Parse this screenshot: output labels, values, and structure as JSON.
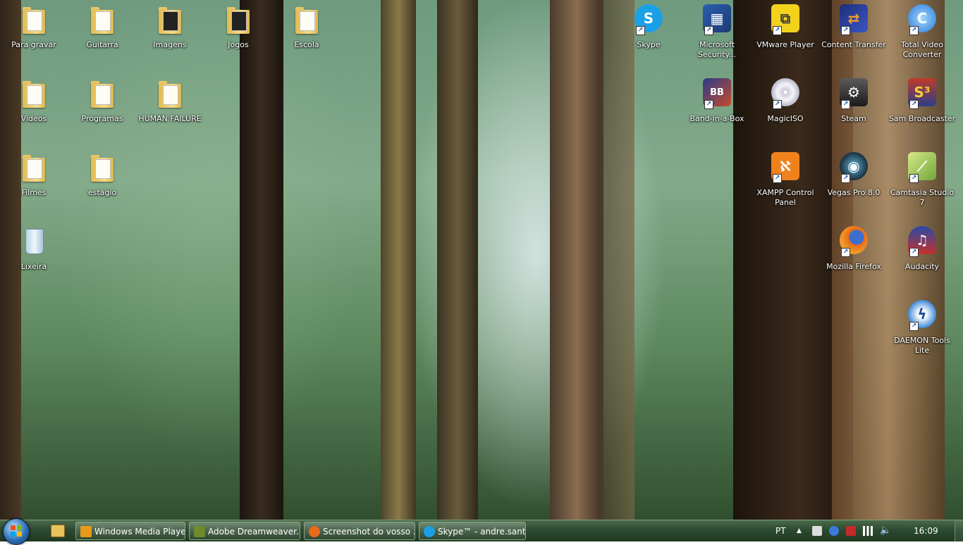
{
  "desktop": {
    "icons": [
      {
        "label": "Para gravar",
        "icon": "folder-icon"
      },
      {
        "label": "Guitarra",
        "icon": "folder-icon"
      },
      {
        "label": "Imagens",
        "icon": "folder-icon"
      },
      {
        "label": "Jogos",
        "icon": "folder-icon"
      },
      {
        "label": "Escola",
        "icon": "folder-icon"
      },
      {
        "label": "Videos",
        "icon": "folder-icon"
      },
      {
        "label": "Programas",
        "icon": "folder-icon"
      },
      {
        "label": "HUMAN FAILURE",
        "icon": "folder-icon"
      },
      {
        "label": "Filmes",
        "icon": "folder-icon"
      },
      {
        "label": "estagio",
        "icon": "folder-icon"
      },
      {
        "label": "Lixeira",
        "icon": "recycle-bin-icon"
      },
      {
        "label": "Skype",
        "icon": "skype-icon"
      },
      {
        "label": "Microsoft Security...",
        "icon": "security-icon"
      },
      {
        "label": "VMware Player",
        "icon": "vmware-icon"
      },
      {
        "label": "Content Transfer",
        "icon": "content-transfer-icon"
      },
      {
        "label": "Total Video Converter",
        "icon": "video-converter-icon"
      },
      {
        "label": "Band-in-a-Box",
        "icon": "band-in-a-box-icon"
      },
      {
        "label": "MagicISO",
        "icon": "disc-icon"
      },
      {
        "label": "Steam",
        "icon": "steam-icon"
      },
      {
        "label": "Sam Broadcaster",
        "icon": "sam-broadcaster-icon"
      },
      {
        "label": "XAMPP Control Panel",
        "icon": "xampp-icon"
      },
      {
        "label": "Vegas Pro 8.0",
        "icon": "vegas-icon"
      },
      {
        "label": "Camtasia Studio 7",
        "icon": "camtasia-icon"
      },
      {
        "label": "Mozilla Firefox",
        "icon": "firefox-icon"
      },
      {
        "label": "Audacity",
        "icon": "audacity-icon"
      },
      {
        "label": "DAEMON Tools Lite",
        "icon": "daemon-tools-icon"
      }
    ]
  },
  "taskbar": {
    "tasks": [
      {
        "label": "Windows Media Player",
        "icon": "media-player-icon"
      },
      {
        "label": "Adobe Dreamweaver...",
        "icon": "dreamweaver-icon"
      },
      {
        "label": "Screenshot do vosso ...",
        "icon": "firefox-icon"
      },
      {
        "label": "Skype™ - andre.sant...",
        "icon": "skype-icon"
      }
    ],
    "tray": {
      "language": "PT",
      "clock": "16:09"
    }
  },
  "colors": {
    "skype": "#1aa0e6",
    "xampp": "#f0821e",
    "steam": "#1b2838",
    "firefox": "#e86a1a",
    "daemon": "#2d7fd6"
  }
}
